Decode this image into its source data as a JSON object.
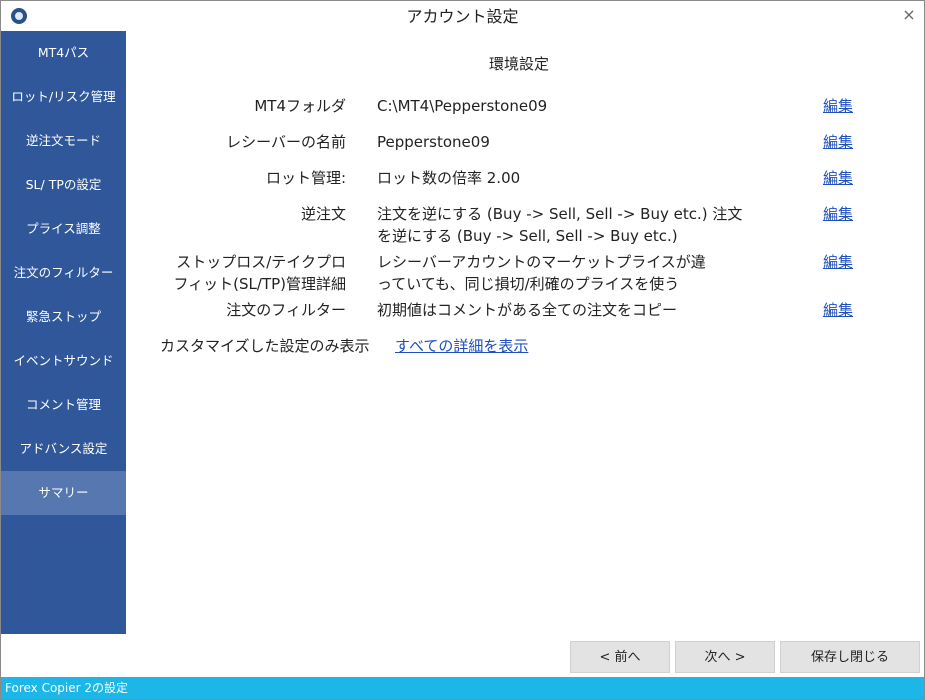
{
  "window": {
    "title": "アカウント設定",
    "close_glyph": "×"
  },
  "sidebar": {
    "items": [
      {
        "label": "MT4パス"
      },
      {
        "label": "ロット/リスク管理"
      },
      {
        "label": "逆注文モード"
      },
      {
        "label": "SL/ TPの設定"
      },
      {
        "label": "プライス調整"
      },
      {
        "label": "注文のフィルター"
      },
      {
        "label": "緊急ストップ"
      },
      {
        "label": "イベントサウンド"
      },
      {
        "label": "コメント管理"
      },
      {
        "label": "アドバンス設定"
      },
      {
        "label": "サマリー"
      }
    ],
    "active_index": 10,
    "colors": {
      "background": "#2f579a",
      "active": "#5677b0"
    }
  },
  "main": {
    "heading": "環境設定",
    "rows": [
      {
        "label": "MT4フォルダ",
        "value": "C:\\MT4\\Pepperstone09",
        "edit": "編集"
      },
      {
        "label": "レシーバーの名前",
        "value": "Pepperstone09",
        "edit": "編集"
      },
      {
        "label": "ロット管理:",
        "value": "ロット数の倍率 2.00",
        "edit": "編集"
      },
      {
        "label": "逆注文",
        "value_lines": [
          "注文を逆にする (Buy -> Sell, Sell -> Buy etc.) 注文",
          "を逆にする (Buy -> Sell, Sell -> Buy etc.)"
        ],
        "edit": "編集"
      },
      {
        "label_lines": [
          "ストップロス/テイクプロ",
          "フィット(SL/TP)管理詳細"
        ],
        "value_lines": [
          "レシーバーアカウントのマーケットプライスが違",
          "っていても、同じ損切/利確のプライスを使う"
        ],
        "edit": "編集"
      },
      {
        "label": "注文のフィルター",
        "value": "初期値はコメントがある全ての注文をコピー",
        "edit": "編集"
      }
    ],
    "filter_text": "カスタマイズした設定のみ表示",
    "show_all_link": "すべての詳細を表示",
    "link_color": "#1f4fbd"
  },
  "footer": {
    "prev": "< 前へ",
    "next": "次へ >",
    "save_close": "保存し閉じる"
  },
  "statusbar": {
    "text": "Forex Copier 2の設定",
    "color": "#1cb7e8"
  }
}
